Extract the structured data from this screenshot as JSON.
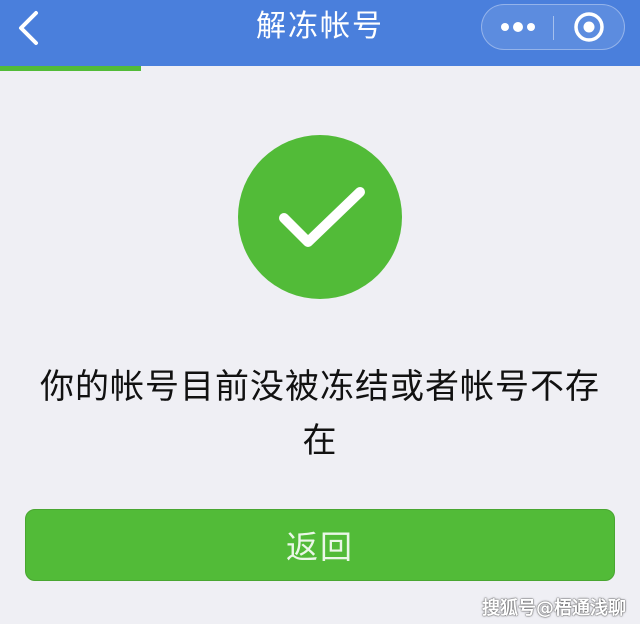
{
  "navbar": {
    "title": "解冻帐号",
    "back_icon": "chevron-left-icon",
    "more_icon": "more-dots-icon",
    "close_icon": "target-circle-icon"
  },
  "progress": {
    "fraction": 0.22,
    "color": "#52bb38"
  },
  "result": {
    "icon": "success-check-icon",
    "icon_color": "#52bb38",
    "message": "你的帐号目前没被冻结或者帐号不存在"
  },
  "actions": {
    "return_label": "返回"
  },
  "watermark": {
    "text": "搜狐号@梧通浅聊"
  },
  "colors": {
    "navbar_bg": "#4a7fdc",
    "page_bg": "#efeff4",
    "primary_green": "#52bb38"
  }
}
